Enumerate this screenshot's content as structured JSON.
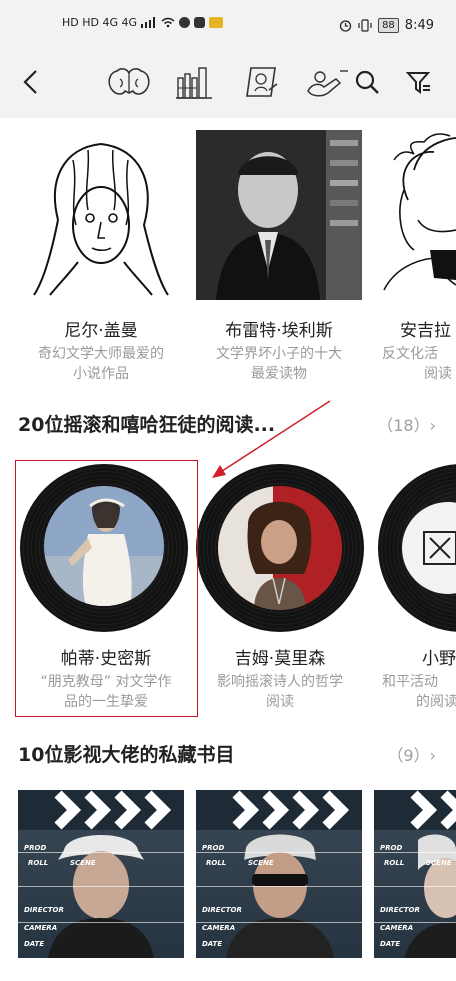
{
  "status_bar": {
    "network_label": "HD HD 4G 4G",
    "battery": "88",
    "time": "8:49"
  },
  "toolbar": {
    "icons": [
      "back-arrow-icon",
      "brain-icon",
      "bookshelf-icon",
      "sketch-icon",
      "magnifier-person-icon",
      "search-icon",
      "filter-icon"
    ]
  },
  "authors_row": {
    "items": [
      {
        "name": "尼尔·盖曼",
        "desc_line1": "奇幻文学大师最爱的",
        "desc_line2": "小说作品"
      },
      {
        "name": "布雷特·埃利斯",
        "desc_line1": "文学界坏小子的十大",
        "desc_line2": "最爱读物"
      },
      {
        "name": "安吉拉",
        "desc_line1": "反文化活",
        "desc_line2": "阅读"
      }
    ]
  },
  "rock_section": {
    "title": "20位摇滚和嘻哈狂徒的阅读...",
    "count": "（18）",
    "chevron": "›",
    "items": [
      {
        "name": "帕蒂·史密斯",
        "desc_line1": "“朋克教母” 对文学作",
        "desc_line2": "品的一生挚爱"
      },
      {
        "name": "吉姆·莫里森",
        "desc_line1": "影响摇滚诗人的哲学",
        "desc_line2": "阅读"
      },
      {
        "name": "小野",
        "desc_line1": "和平活动",
        "desc_line2": "的阅读"
      }
    ]
  },
  "film_section": {
    "title": "10位影视大佬的私藏书目",
    "count": "（9）",
    "chevron": "›",
    "board_labels": {
      "prod": "PROD",
      "roll": "ROLL",
      "scene": "SCENE",
      "director": "DIRECTOR",
      "camera": "CAMERA",
      "date": "DATE"
    }
  }
}
